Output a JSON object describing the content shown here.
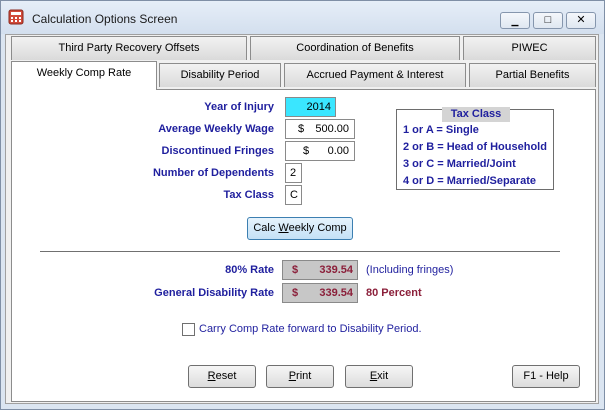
{
  "window": {
    "title": "Calculation Options Screen",
    "minimize_glyph": "▭",
    "maximize_glyph": "□",
    "close_glyph": "✕"
  },
  "tabs_row1": [
    "Third Party Recovery Offsets",
    "Coordination of Benefits",
    "PIWEC"
  ],
  "tabs_row2": [
    "Weekly Comp Rate",
    "Disability Period",
    "Accrued Payment & Interest",
    "Partial Benefits"
  ],
  "form": {
    "year_of_injury": {
      "label": "Year of Injury",
      "value": "2014"
    },
    "average_weekly_wage": {
      "label": "Average Weekly Wage",
      "currency": "$",
      "value": "500.00"
    },
    "discontinued_fringes": {
      "label": "Discontinued Fringes",
      "currency": "$",
      "value": "0.00"
    },
    "number_of_dependents": {
      "label": "Number of Dependents",
      "value": "2"
    },
    "tax_class": {
      "label": "Tax Class",
      "value": "C"
    }
  },
  "tax_class_box": {
    "title": "Tax Class",
    "items": [
      "1 or A = Single",
      "2 or B = Head of Household",
      "3 or C = Married/Joint",
      "4 or D = Married/Separate"
    ]
  },
  "calc_button": {
    "pre": "Calc ",
    "underlined": "W",
    "post": "eekly Comp"
  },
  "results": {
    "rate_80": {
      "label": "80% Rate",
      "currency": "$",
      "value": "339.54",
      "note": "(Including fringes)"
    },
    "general_disability": {
      "label": "General Disability Rate",
      "currency": "$",
      "value": "339.54",
      "note": "80 Percent"
    }
  },
  "carry_forward": {
    "label": "Carry Comp Rate forward to Disability Period.",
    "checked": false
  },
  "buttons": {
    "reset": {
      "underlined": "R",
      "rest": "eset"
    },
    "print": {
      "underlined": "P",
      "rest": "rint"
    },
    "exit": {
      "underlined": "E",
      "rest": "xit"
    },
    "help": "F1 - Help"
  },
  "colors": {
    "label_blue": "#1f1f9e",
    "result_red": "#8b1f3a",
    "highlight_cyan": "#3ae6ff"
  }
}
